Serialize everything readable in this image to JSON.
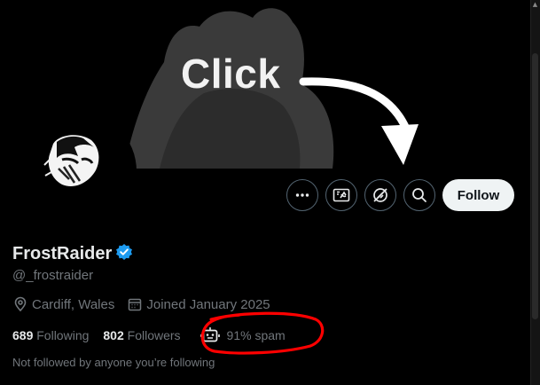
{
  "banner": {
    "overlay_text": "Click"
  },
  "profile": {
    "display_name": "FrostRaider",
    "handle": "@_frostraider",
    "location": "Cardiff, Wales",
    "joined": "Joined January 2025",
    "following_count": "689",
    "following_label": "Following",
    "followers_count": "802",
    "followers_label": "Followers",
    "spam_text": "91% spam",
    "followed_by_note": "Not followed by anyone you’re following"
  },
  "actions": {
    "follow_label": "Follow",
    "icons": [
      "more-icon",
      "grok-icon",
      "mute-icon",
      "search-icon"
    ]
  },
  "colors": {
    "background": "#000000",
    "primary_text": "#e7e9ea",
    "secondary_text": "#71767b",
    "verified_blue": "#1d9bf0",
    "follow_button_bg": "#eff3f4",
    "annotation_red": "#ff0000"
  }
}
